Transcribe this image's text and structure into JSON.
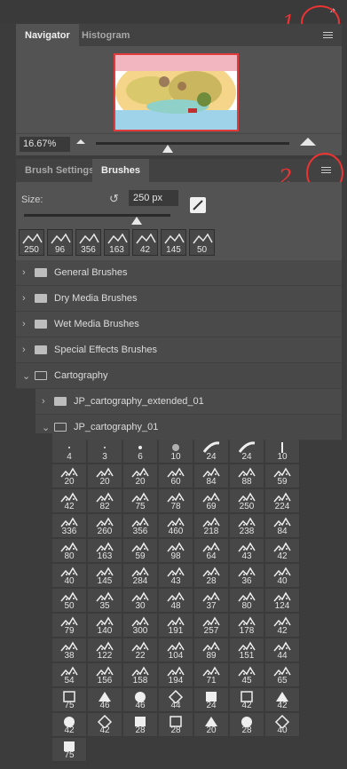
{
  "window": {
    "collapse_glyph": "››",
    "annotations": [
      "1",
      "2"
    ]
  },
  "navigator": {
    "tabs": [
      "Navigator",
      "Histogram"
    ],
    "zoom_value": "16.67%",
    "zoom_slider_fraction": 0.55
  },
  "brushes_panel": {
    "tabs": [
      "Brush Settings",
      "Brushes"
    ],
    "size_label": "Size:",
    "size_value": "250 px",
    "size_slider_fraction": 0.5,
    "recent_brushes": [
      "250",
      "96",
      "356",
      "163",
      "42",
      "145",
      "50"
    ],
    "folders": [
      {
        "label": "General Brushes",
        "expanded": false
      },
      {
        "label": "Dry Media Brushes",
        "expanded": false
      },
      {
        "label": "Wet Media Brushes",
        "expanded": false
      },
      {
        "label": "Special Effects Brushes",
        "expanded": false
      },
      {
        "label": "Cartography",
        "expanded": true
      },
      {
        "label": "JP_cartography_extended_01",
        "expanded": false
      },
      {
        "label": "JP_cartography_01",
        "expanded": true
      }
    ],
    "brush_grid": [
      [
        "4",
        "3",
        "6",
        "10",
        "24",
        "24",
        "10"
      ],
      [
        "20",
        "20",
        "20",
        "60",
        "84",
        "88",
        "59"
      ],
      [
        "42",
        "82",
        "75",
        "78",
        "69",
        "250",
        "224"
      ],
      [
        "336",
        "260",
        "356",
        "460",
        "218",
        "238",
        "84"
      ],
      [
        "80",
        "163",
        "59",
        "98",
        "64",
        "43",
        "42"
      ],
      [
        "40",
        "145",
        "284",
        "43",
        "28",
        "36",
        "40"
      ],
      [
        "50",
        "35",
        "30",
        "48",
        "37",
        "80",
        "124"
      ],
      [
        "79",
        "140",
        "300",
        "191",
        "257",
        "178",
        "42"
      ],
      [
        "38",
        "122",
        "22",
        "104",
        "89",
        "151",
        "44"
      ],
      [
        "54",
        "156",
        "158",
        "194",
        "71",
        "45",
        "65"
      ],
      [
        "75",
        "46",
        "46",
        "44",
        "24",
        "42",
        "42"
      ],
      [
        "42",
        "42",
        "28",
        "28",
        "20",
        "28",
        "40"
      ],
      [
        "75"
      ]
    ]
  }
}
